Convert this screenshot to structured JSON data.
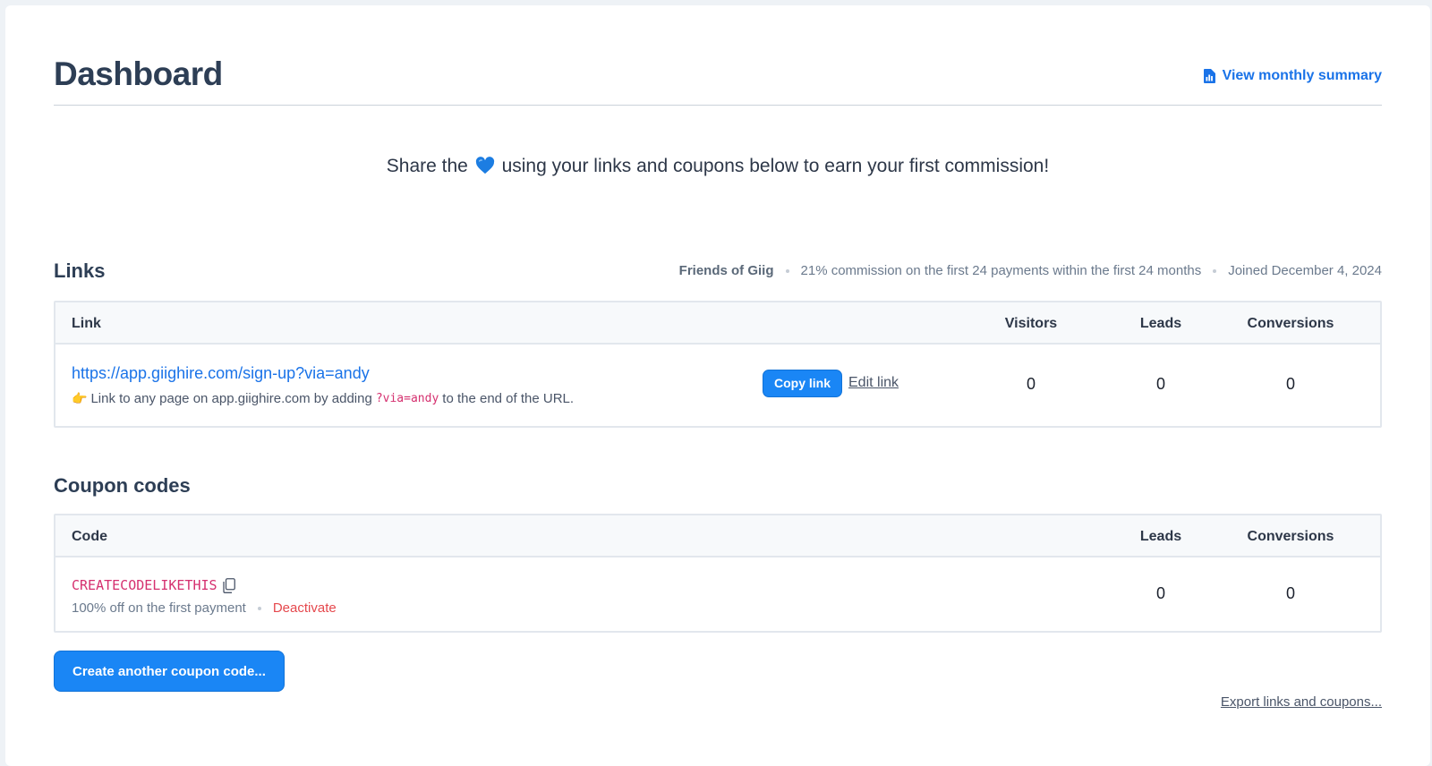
{
  "header": {
    "title": "Dashboard",
    "summary_link": "View monthly summary"
  },
  "share": {
    "before": "Share the",
    "after": "using your links and coupons below to earn your first commission!"
  },
  "links": {
    "title": "Links",
    "program": "Friends of Giig",
    "commission": "21% commission on the first 24 payments within the first 24 months",
    "joined": "Joined December 4, 2024",
    "columns": {
      "link": "Link",
      "visitors": "Visitors",
      "leads": "Leads",
      "conversions": "Conversions"
    },
    "rows": [
      {
        "url": "https://app.giighire.com/sign-up?via=andy",
        "hint_before": "Link to any page on app.giighire.com by adding",
        "hint_code": "?via=andy",
        "hint_after": "to the end of the URL.",
        "copy_label": "Copy link",
        "edit_label": "Edit link",
        "visitors": "0",
        "leads": "0",
        "conversions": "0"
      }
    ]
  },
  "coupons": {
    "title": "Coupon codes",
    "columns": {
      "code": "Code",
      "leads": "Leads",
      "conversions": "Conversions"
    },
    "rows": [
      {
        "code": "CREATECODELIKETHIS",
        "description": "100% off on the first payment",
        "deactivate": "Deactivate",
        "leads": "0",
        "conversions": "0"
      }
    ],
    "create_label": "Create another coupon code...",
    "export_label": "Export links and coupons..."
  },
  "colors": {
    "accent": "#1a86f5",
    "link": "#1a73e8",
    "code": "#d5306f",
    "danger": "#e5484d"
  },
  "icons": {
    "summary": "bar-chart-document-icon",
    "heart": "blue-heart-icon",
    "hint": "pointing-hand-icon",
    "copy": "copy-icon"
  }
}
